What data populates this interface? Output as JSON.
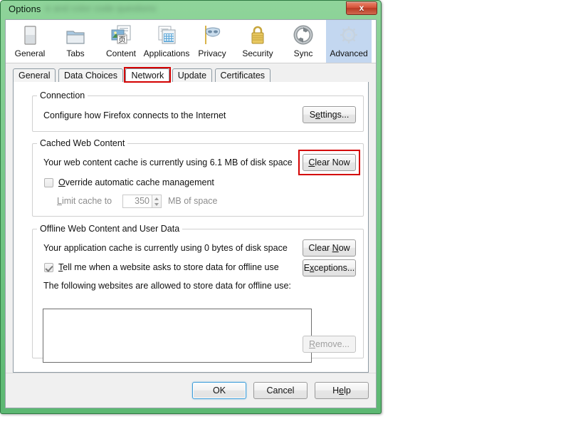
{
  "window": {
    "title": "Options",
    "title_blurred_suffix": "e and color code questions",
    "close_label": "x",
    "close_icon": "close-icon"
  },
  "categories": [
    {
      "label": "General",
      "icon": "general-icon",
      "selected": false
    },
    {
      "label": "Tabs",
      "icon": "tabs-folder-icon",
      "selected": false
    },
    {
      "label": "Content",
      "icon": "content-icon",
      "selected": false
    },
    {
      "label": "Applications",
      "icon": "applications-icon",
      "selected": false
    },
    {
      "label": "Privacy",
      "icon": "privacy-mask-icon",
      "selected": false
    },
    {
      "label": "Security",
      "icon": "security-lock-icon",
      "selected": false
    },
    {
      "label": "Sync",
      "icon": "sync-icon",
      "selected": false
    },
    {
      "label": "Advanced",
      "icon": "advanced-gear-icon",
      "selected": true
    }
  ],
  "tabs": [
    {
      "label": "General",
      "active": false,
      "highlighted": false
    },
    {
      "label": "Data Choices",
      "active": false,
      "highlighted": false
    },
    {
      "label": "Network",
      "active": true,
      "highlighted": true
    },
    {
      "label": "Update",
      "active": false,
      "highlighted": false
    },
    {
      "label": "Certificates",
      "active": false,
      "highlighted": false
    }
  ],
  "connection": {
    "legend": "Connection",
    "description": "Configure how Firefox connects to the Internet",
    "settings_button": {
      "prefix": "S",
      "accesskey": "e",
      "suffix": "ttings..."
    }
  },
  "cached_web_content": {
    "legend": "Cached Web Content",
    "usage_text": "Your web content cache is currently using 6.1 MB of disk space",
    "clear_button": {
      "prefix": "",
      "accesskey": "C",
      "suffix": "lear Now"
    },
    "override_checkbox": {
      "checked": false,
      "prefix": "",
      "accesskey": "O",
      "suffix": "verride automatic cache management"
    },
    "limit_label": {
      "prefix": "",
      "accesskey": "L",
      "suffix": "imit cache to"
    },
    "limit_value": "350",
    "limit_units": "MB of space",
    "clear_button_highlighted": true
  },
  "offline_web_content": {
    "legend": "Offline Web Content and User Data",
    "usage_text": "Your application cache is currently using 0 bytes of disk space",
    "clear_button": {
      "prefix": "Clear ",
      "accesskey": "N",
      "suffix": "ow"
    },
    "exceptions_button": {
      "prefix": "E",
      "accesskey": "x",
      "suffix": "ceptions..."
    },
    "tell_me_checkbox": {
      "checked": true,
      "prefix": "",
      "accesskey": "T",
      "suffix": "ell me when a website asks to store data for offline use"
    },
    "list_label": "The following websites are allowed to store data for offline use:",
    "site_list_items": [],
    "remove_button": {
      "prefix": "",
      "accesskey": "R",
      "suffix": "emove...",
      "disabled": true
    }
  },
  "footer": {
    "ok": {
      "prefix": "OK",
      "accesskey": "",
      "suffix": ""
    },
    "cancel": {
      "prefix": "Cancel",
      "accesskey": "",
      "suffix": ""
    },
    "help": {
      "prefix": "H",
      "accesskey": "e",
      "suffix": "lp"
    }
  },
  "colors": {
    "window_border_green": "#5cb872",
    "highlight_red": "#d40000",
    "selected_category_blue": "#c3d7f0",
    "default_button_focus_blue": "#3c9cd8"
  }
}
